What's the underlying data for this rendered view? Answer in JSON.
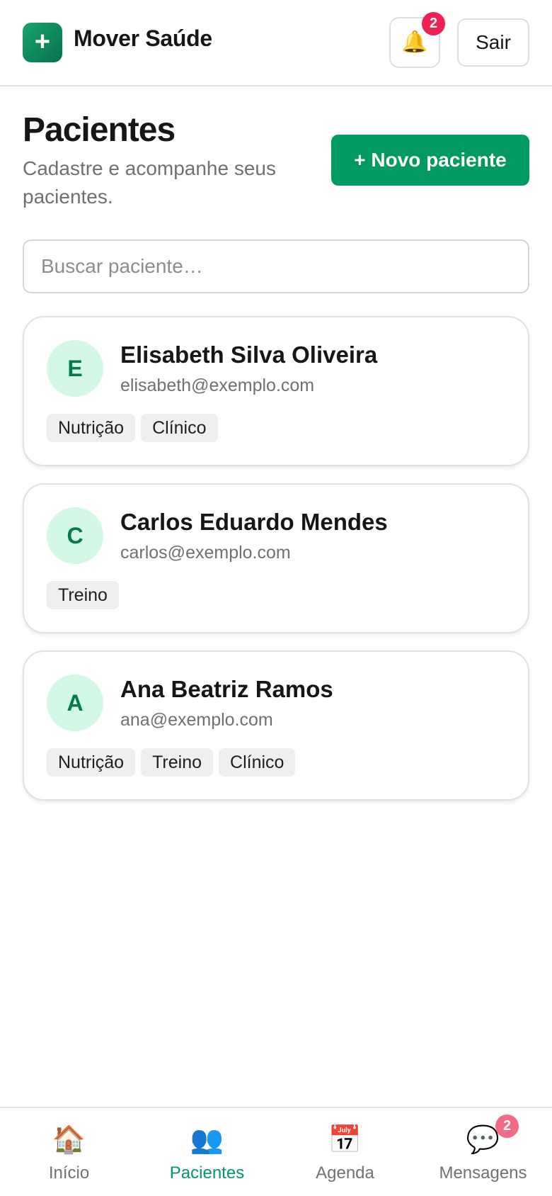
{
  "header": {
    "logo_symbol": "+",
    "brand": "Mover Saúde",
    "notifications_icon": "bell-icon",
    "notifications_count": "2",
    "logout_label": "Sair"
  },
  "page": {
    "title": "Pacientes",
    "subtitle": "Cadastre e acompanhe seus pacientes.",
    "new_button_label": "+ Novo paciente"
  },
  "search": {
    "value": "",
    "placeholder": "Buscar paciente…"
  },
  "patients": [
    {
      "initial": "E",
      "name": "Elisabeth Silva Oliveira",
      "email": "elisabeth@exemplo.com",
      "tags": [
        "Nutrição",
        "Clínico"
      ]
    },
    {
      "initial": "C",
      "name": "Carlos Eduardo Mendes",
      "email": "carlos@exemplo.com",
      "tags": [
        "Treino"
      ]
    },
    {
      "initial": "A",
      "name": "Ana Beatriz Ramos",
      "email": "ana@exemplo.com",
      "tags": [
        "Nutrição",
        "Treino",
        "Clínico"
      ]
    }
  ],
  "bottom_nav": {
    "items": [
      {
        "icon": "house-icon",
        "glyph": "🏠",
        "label": "Início",
        "active": false
      },
      {
        "icon": "people-icon",
        "glyph": "👥",
        "label": "Pacientes",
        "active": true
      },
      {
        "icon": "calendar-icon",
        "glyph": "📅",
        "label": "Agenda",
        "active": false
      },
      {
        "icon": "speech-bubble-icon",
        "glyph": "💬",
        "label": "Mensagens",
        "active": false
      }
    ],
    "messages_badge": "2"
  },
  "colors": {
    "accent": "#029963",
    "badge_red": "#ee2153",
    "badge_pink": "#f36987",
    "avatar_bg": "#d3f8e6",
    "avatar_text": "#057a4d"
  }
}
